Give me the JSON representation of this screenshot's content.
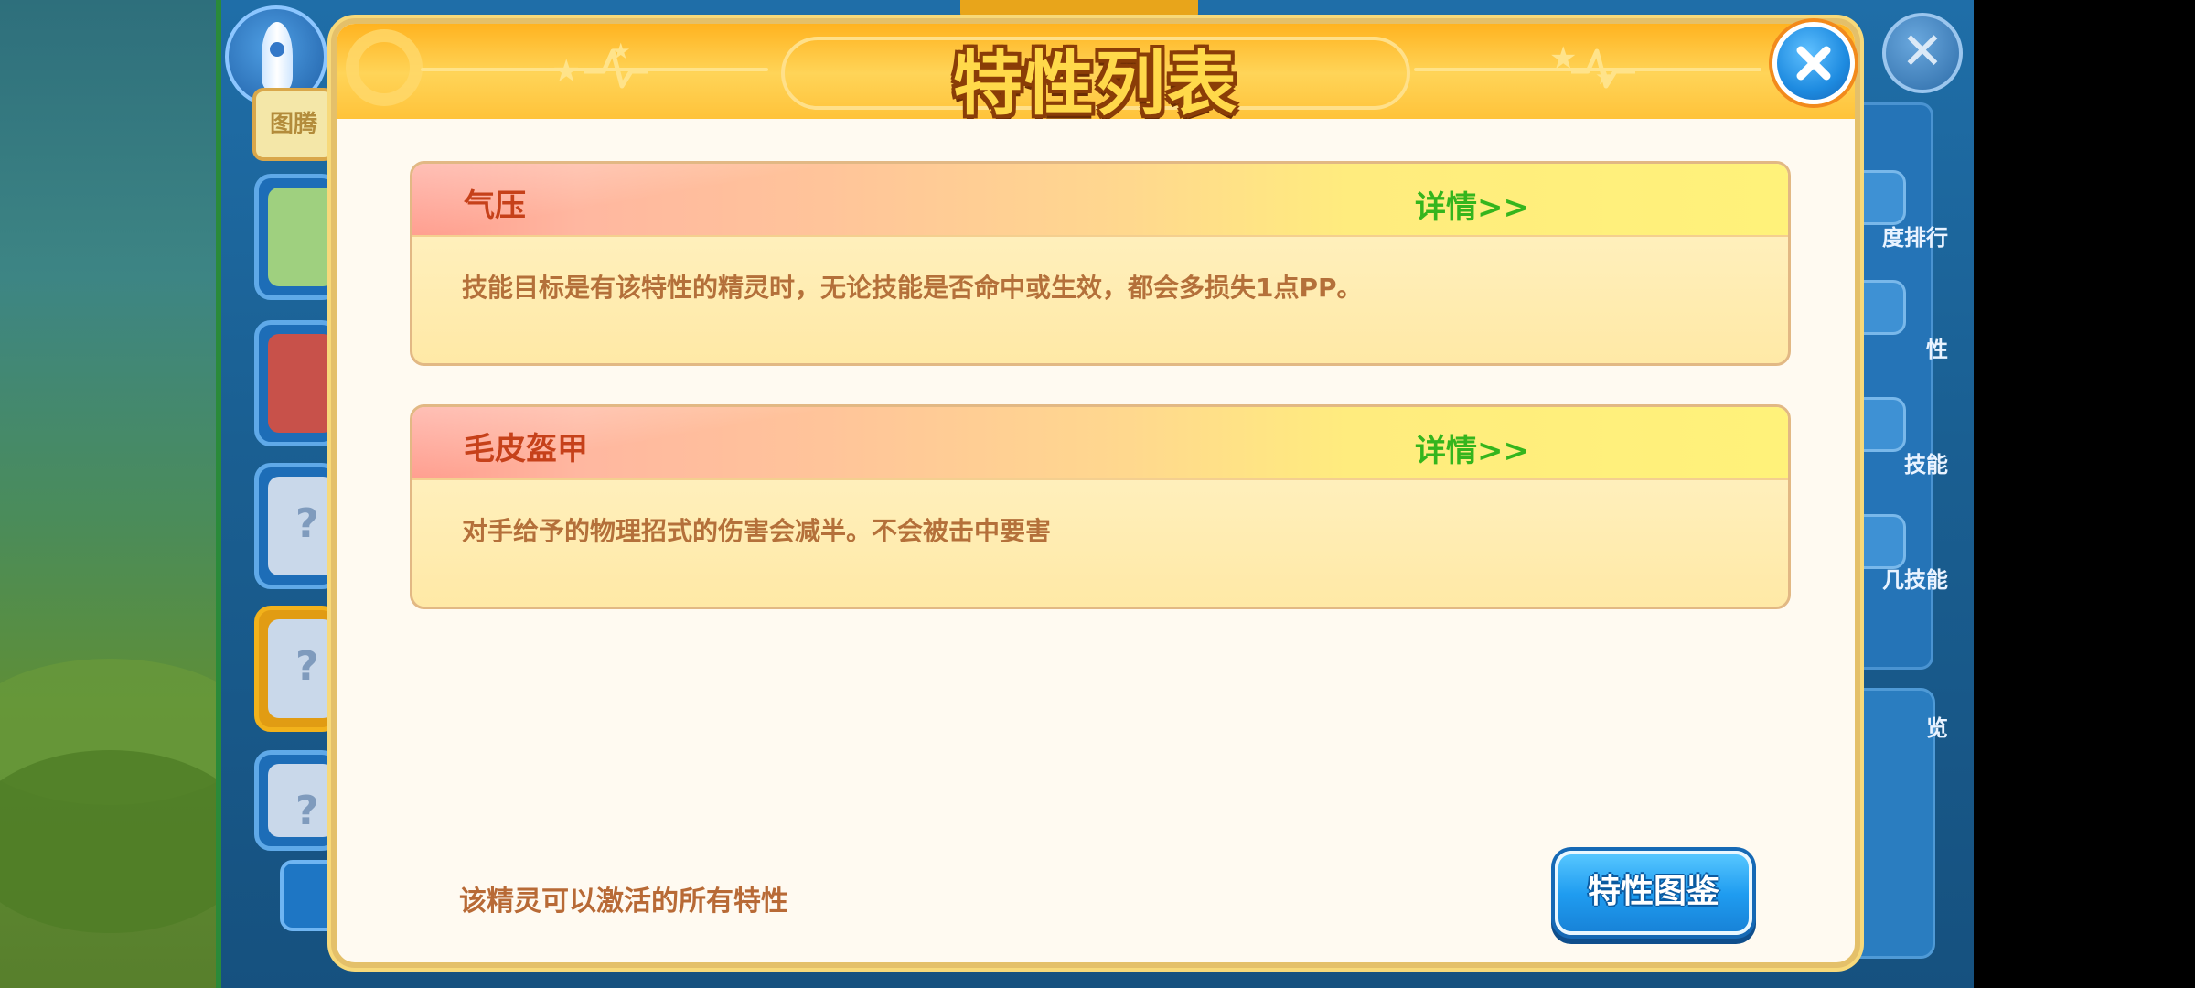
{
  "dialog": {
    "title": "特性列表",
    "close_icon": "close-x-icon",
    "traits": [
      {
        "name": "气压",
        "detail_link": "详情>>",
        "description": "技能目标是有该特性的精灵时，无论技能是否命中或生效，都会多损失1点PP。"
      },
      {
        "name": "毛皮盔甲",
        "detail_link": "详情>>",
        "description": "对手给予的物理招式的伤害会减半。不会被击中要害"
      }
    ],
    "footer_note": "该精灵可以激活的所有特性",
    "atlas_button": "特性图鉴"
  },
  "background": {
    "tab_label": "图腾",
    "right_labels": [
      "度排行",
      "性",
      "技能",
      "几技能",
      "览"
    ],
    "colors": {
      "accent_orange": "#ffb320",
      "detail_green": "#35b51d",
      "name_red": "#c6411a",
      "button_blue": "#1f9cf0"
    }
  }
}
